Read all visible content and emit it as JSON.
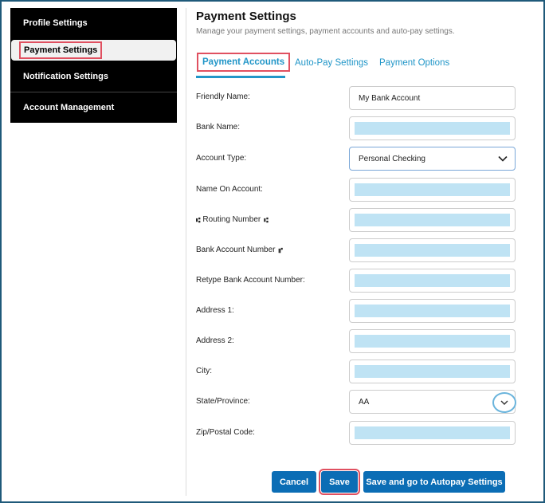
{
  "sidebar": {
    "items": [
      {
        "label": "Profile Settings"
      },
      {
        "label": "Payment Settings"
      },
      {
        "label": "Notification Settings"
      },
      {
        "label": "Account Management"
      }
    ]
  },
  "header": {
    "title": "Payment Settings",
    "subtitle": "Manage your payment settings, payment accounts and auto-pay settings."
  },
  "tabs": [
    {
      "label": "Payment Accounts"
    },
    {
      "label": "Auto-Pay Settings"
    },
    {
      "label": "Payment Options"
    }
  ],
  "form": {
    "friendly_name": {
      "label": "Friendly Name:",
      "value": "My Bank Account"
    },
    "bank_name": {
      "label": "Bank Name:"
    },
    "account_type": {
      "label": "Account Type:",
      "value": "Personal Checking"
    },
    "name_on_account": {
      "label": "Name On Account:"
    },
    "routing_number": {
      "label": "Routing Number"
    },
    "bank_account_number": {
      "label": "Bank Account Number"
    },
    "retype_account": {
      "label": "Retype Bank Account Number:"
    },
    "address1": {
      "label": "Address 1:"
    },
    "address2": {
      "label": "Address 2:"
    },
    "city": {
      "label": "City:"
    },
    "state": {
      "label": "State/Province:",
      "value": "AA"
    },
    "zip": {
      "label": "Zip/Postal Code:"
    }
  },
  "buttons": {
    "cancel": "Cancel",
    "save": "Save",
    "save_autopay": "Save and go to Autopay Settings"
  },
  "icons": {
    "routing": "⑆",
    "account": "⑈"
  }
}
